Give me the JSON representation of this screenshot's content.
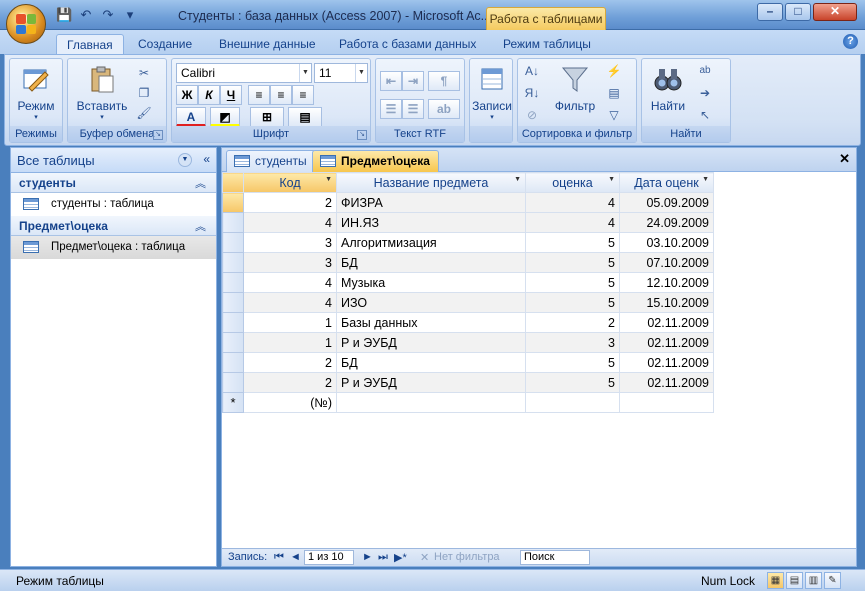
{
  "window": {
    "title": "Студенты : база данных (Access 2007) - Microsoft Ac...",
    "context_tab": "Работа с таблицами",
    "controls": {
      "minimize": "–",
      "maximize": "□",
      "close": "✕"
    }
  },
  "quick_access": {
    "save": "💾",
    "undo": "↶",
    "redo": "↷",
    "customize": "▾"
  },
  "ribbon_tabs": [
    "Главная",
    "Создание",
    "Внешние данные",
    "Работа с базами данных",
    "Режим таблицы"
  ],
  "help": "?",
  "ribbon": {
    "groups": {
      "views": {
        "label": "Режимы",
        "button": "Режим"
      },
      "clipboard": {
        "label": "Буфер обмена",
        "button": "Вставить"
      },
      "font": {
        "label": "Шрифт",
        "font_name": "Calibri",
        "font_size": "11",
        "bold": "Ж",
        "italic": "К",
        "underline": "Ч",
        "font_color": "A"
      },
      "rtf": {
        "label": "Текст RTF"
      },
      "records": {
        "label": "",
        "button": "Записи"
      },
      "sort_filter": {
        "label": "Сортировка и фильтр",
        "button": "Фильтр"
      },
      "find": {
        "label": "Найти",
        "button": "Найти"
      }
    }
  },
  "nav_pane": {
    "title": "Все таблицы",
    "groups": [
      {
        "name": "студенты",
        "items": [
          "студенты : таблица"
        ]
      },
      {
        "name": "Предмет\\оцека",
        "items": [
          "Предмет\\оцека : таблица"
        ]
      }
    ]
  },
  "doc_tabs": [
    "студенты",
    "Предмет\\оцека"
  ],
  "datasheet": {
    "columns": [
      "Код",
      "Название предмета",
      "оценка",
      "Дата оценк"
    ],
    "rows": [
      [
        "2",
        "ФИЗРА",
        "4",
        "05.09.2009"
      ],
      [
        "4",
        "ИН.ЯЗ",
        "4",
        "24.09.2009"
      ],
      [
        "3",
        "Алгоритмизация",
        "5",
        "03.10.2009"
      ],
      [
        "3",
        "БД",
        "5",
        "07.10.2009"
      ],
      [
        "4",
        "Музыка",
        "5",
        "12.10.2009"
      ],
      [
        "4",
        "ИЗО",
        "5",
        "15.10.2009"
      ],
      [
        "1",
        "Базы данных",
        "2",
        "02.11.2009"
      ],
      [
        "1",
        "Р и ЭУБД",
        "3",
        "02.11.2009"
      ],
      [
        "2",
        "БД",
        "5",
        "02.11.2009"
      ],
      [
        "2",
        "Р и ЭУБД",
        "5",
        "02.11.2009"
      ]
    ],
    "new_row_marker": "*",
    "new_row_value": "(№)"
  },
  "record_nav": {
    "label": "Запись:",
    "first": "⏮",
    "prev": "◄",
    "position": "1 из 10",
    "next": "►",
    "last": "⏭",
    "new": "▶*",
    "filter": "Нет фильтра",
    "search": "Поиск"
  },
  "status": {
    "mode": "Режим таблицы",
    "numlock": "Num Lock"
  }
}
